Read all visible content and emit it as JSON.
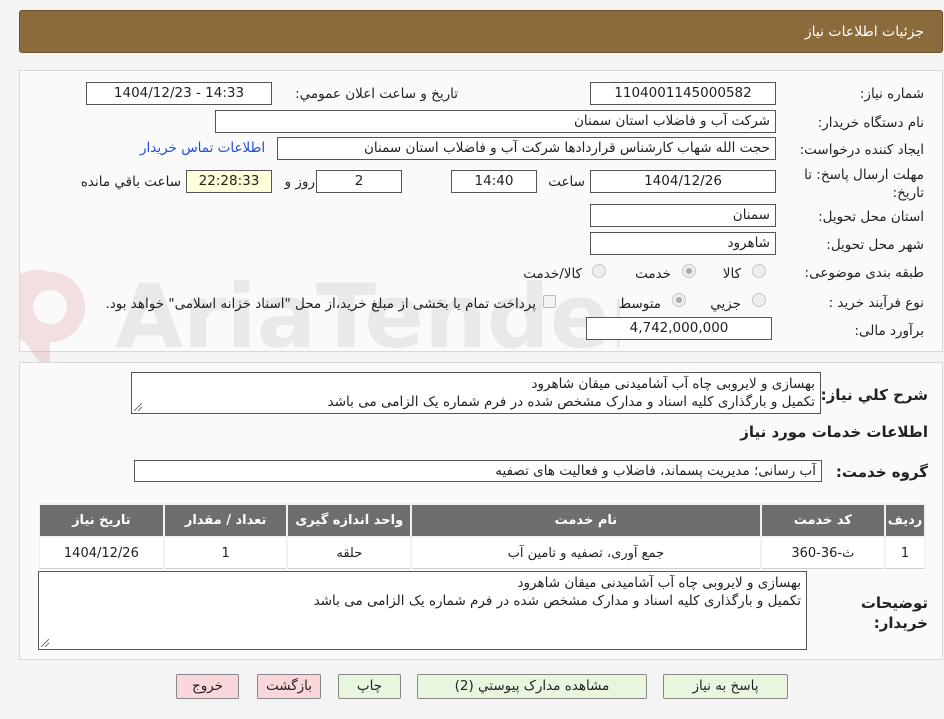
{
  "header": {
    "title": "جزئیات اطلاعات نیاز"
  },
  "form": {
    "need_number_label": "شماره نیاز:",
    "need_number": "1104001145000582",
    "announce_label": "تاریخ و ساعت اعلان عمومي:",
    "announce_value": "1404/12/23 - 14:33",
    "buyer_org_label": "نام دستگاه خريدار:",
    "buyer_org": "شرکت آب و فاضلاب استان سمنان",
    "requester_label": "ايجاد کننده درخواست:",
    "requester": "حجت الله شهاب کارشناس قراردادها شرکت آب و فاضلاب استان سمنان",
    "contact_link": "اطلاعات تماس خريدار",
    "deadline_label": "مهلت ارسال پاسخ: تا تاريخ:",
    "deadline_date": "1404/12/26",
    "time_label": "ساعت",
    "deadline_time": "14:40",
    "days_value": "2",
    "days_label": "روز و",
    "remaining_time": "22:28:33",
    "remaining_label": "ساعت باقي مانده",
    "province_label": "استان محل تحويل:",
    "province": "سمنان",
    "city_label": "شهر محل تحويل:",
    "city": "شاهرود",
    "category_label": "طبقه بندی موضوعی:",
    "category_options": [
      "کالا",
      "خدمت",
      "کالا/خدمت"
    ],
    "category_selected": "خدمت",
    "process_label": "نوع فرآيند خريد :",
    "process_options": [
      "جزيي",
      "متوسط"
    ],
    "process_selected": "متوسط",
    "payment_note": "پرداخت تمام يا بخشی از مبلغ خريد،از محل \"اسناد خزانه اسلامی\" خواهد بود.",
    "budget_label": "برآورد مالی:",
    "budget": "4,742,000,000"
  },
  "summary": {
    "label": "شرح کلي نياز:",
    "lines": [
      "بهسازی و لایروبی چاه آب آشامیدنی میقان شاهرود",
      "تکمیل و بارگذاری کلیه اسناد و مدارک مشخص شده در فرم شماره یک الزامی می باشد"
    ]
  },
  "services": {
    "title": "اطلاعات خدمات مورد نياز",
    "group_label": "گروه خدمت:",
    "group_value": "آب رسانی؛ مدیریت پسماند، فاضلاب و فعالیت های تصفیه",
    "columns": [
      "رديف",
      "کد خدمت",
      "نام خدمت",
      "واحد اندازه گيری",
      "تعداد / مقدار",
      "تاريخ نياز"
    ],
    "rows": [
      [
        "1",
        "ث-36-360",
        "جمع آوری، تصفیه و تامین آب",
        "حلقه",
        "1",
        "1404/12/26"
      ]
    ]
  },
  "buyer_notes": {
    "label": "توضيحات خريدار:",
    "lines": [
      "بهسازی و لایروبی چاه آب آشامیدنی میقان شاهرود",
      "تکمیل و بارگذاری کلیه اسناد و مدارک مشخص شده در فرم شماره یک الزامی می باشد"
    ]
  },
  "buttons": {
    "reply": "پاسخ به نياز",
    "attachments": "مشاهده مدارک پيوستي (2)",
    "print": "چاپ",
    "back": "بازگشت",
    "exit": "خروج"
  },
  "watermark": {
    "text": "AriaTender.net"
  }
}
